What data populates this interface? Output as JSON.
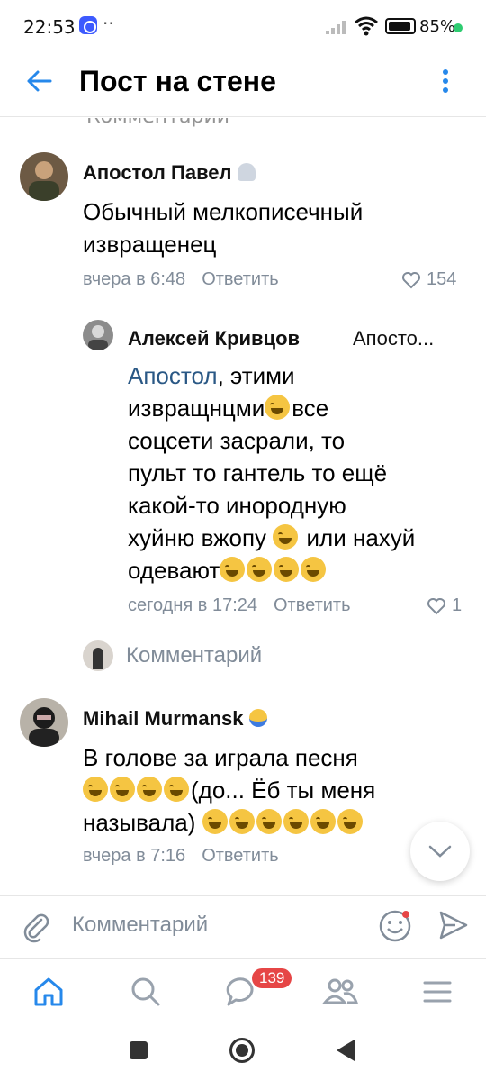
{
  "status_bar": {
    "time": "22:53",
    "dots": "··",
    "battery": "85%"
  },
  "header": {
    "title": "Пост на стене"
  },
  "ghost_row_label": "Комментарий",
  "comments": [
    {
      "author": "Апостол Павел",
      "text": "Обычный мелкописечный извращенец",
      "time": "вчера в 6:48",
      "reply_label": "Ответить",
      "likes": "154"
    },
    {
      "author": "Алексей Кривцов",
      "reply_to": "Апосто...",
      "mention": "Апостол",
      "text_lines": [
        ", этими",
        "извращнцми",
        "все",
        "соцсети засрали, то",
        "пульт то гантель то ещё",
        "какой-то инородную",
        "хуйню вжопу",
        "или нахуй",
        "одевают"
      ],
      "time": "сегодня в 17:24",
      "reply_label": "Ответить",
      "likes": "1"
    },
    {
      "author": "Mihail Murmansk",
      "text_lines": [
        "В голове за играла песня",
        "(до... Ёб ты меня",
        "называла)"
      ],
      "time": "вчера в 7:16",
      "reply_label": "Ответить"
    }
  ],
  "write_comment_label": "Комментарий",
  "composer": {
    "placeholder": "Комментарий"
  },
  "bottom_nav": {
    "messages_badge": "139"
  },
  "colors": {
    "accent": "#2688eb",
    "meta": "#818c99",
    "badge": "#e64646"
  }
}
